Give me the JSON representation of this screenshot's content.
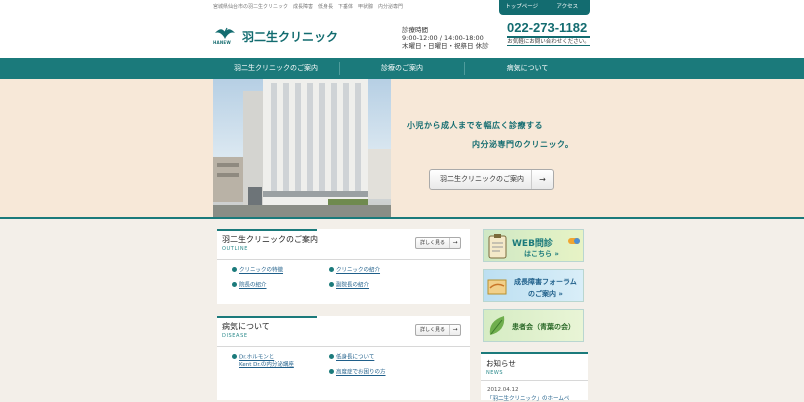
{
  "header": {
    "tagline": "宮城県仙台市の羽二生クリニック　成長障害　低身長　下垂体　甲状腺　内分泌専門",
    "logo_sub": "HANEW",
    "logo_text": "羽二生クリニック",
    "hours_title": "診療時間",
    "hours_time": "9:00-12:00 / 14:00-18:00",
    "hours_closed": "木曜日・日曜日・祝祭日 休診",
    "top_links": [
      "トップページ",
      "アクセス"
    ],
    "phone": "022-273-1182",
    "contact": "お気軽にお問い合わせください。"
  },
  "nav": {
    "items": [
      "羽二生クリニックのご案内",
      "診療のご案内",
      "病気について"
    ]
  },
  "hero": {
    "copy_line1": "小児から成人までを幅広く診療する",
    "copy_line2": "内分泌専門のクリニック。",
    "button": "羽二生クリニックのご案内",
    "button_arrow": "→"
  },
  "outline": {
    "title": "羽二生クリニックのご案内",
    "subtitle": "OUTLINE",
    "more": "詳しく見る",
    "arrow": "→",
    "links": [
      "クリニックの特徴",
      "クリニックの紹介",
      "院長の紹介",
      "副院長の紹介"
    ]
  },
  "disease": {
    "title": "病気について",
    "subtitle": "DISEASE",
    "more": "詳しく見る",
    "arrow": "→",
    "links": [
      "Dr.ホルモンと",
      "Kent Dr.の内分泌講座",
      "低身長について",
      "高度症でお困りの方"
    ]
  },
  "sidebar": {
    "banner_web_1": "WEB問診",
    "banner_web_2": "はこちら »",
    "banner_growth_1": "成長障害フォーラム",
    "banner_growth_2": "のご案内 »",
    "banner_patient": "患者会（青葉の会）",
    "news_title": "お知らせ",
    "news_sub": "NEWS",
    "news_date": "2012.04.12",
    "news_item": "「羽二生クリニック」のホームペ"
  },
  "colors": {
    "brand": "#1b7a7b",
    "hero_bg": "#f7e8d8",
    "page_bg": "#f3efe9"
  }
}
